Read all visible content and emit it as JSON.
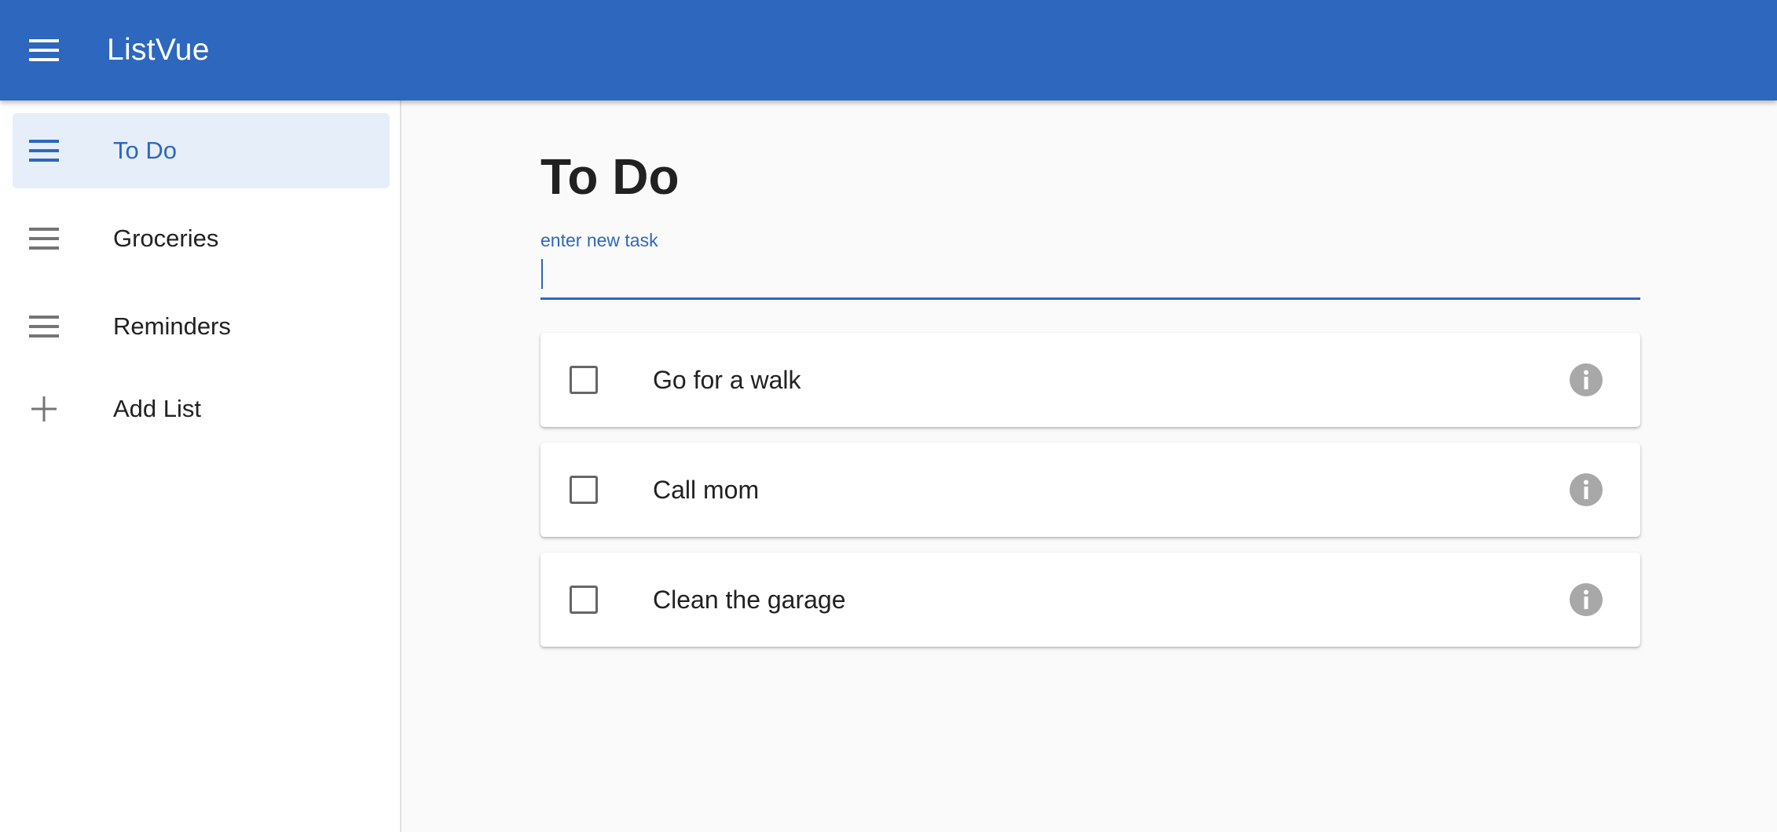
{
  "app": {
    "title": "ListVue",
    "menu_icon": "hamburger-menu-icon",
    "accent_color": "#2d67be"
  },
  "sidebar": {
    "items": [
      {
        "label": "To Do",
        "icon": "list-icon",
        "active": true
      },
      {
        "label": "Groceries",
        "icon": "list-icon",
        "active": false
      },
      {
        "label": "Reminders",
        "icon": "list-icon",
        "active": false
      },
      {
        "label": "Add List",
        "icon": "plus-icon",
        "active": false
      }
    ]
  },
  "main": {
    "title": "To Do",
    "input": {
      "label": "enter new task",
      "value": ""
    },
    "tasks": [
      {
        "label": "Go for a walk",
        "checked": false,
        "info_icon": "info-icon"
      },
      {
        "label": "Call mom",
        "checked": false,
        "info_icon": "info-icon"
      },
      {
        "label": "Clean the garage",
        "checked": false,
        "info_icon": "info-icon"
      }
    ]
  }
}
